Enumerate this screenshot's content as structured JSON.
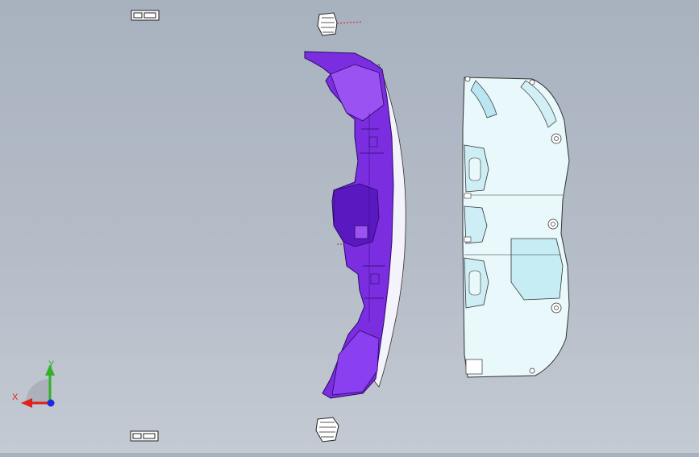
{
  "viewport": {
    "axis_triad": {
      "x_label": "X",
      "y_label": "Y",
      "x_color": "#e0201c",
      "y_color": "#2fb12a",
      "z_color": "#1c2bd8"
    },
    "part_colors": {
      "purple_panel": "#7a2ee0",
      "purple_dark": "#4a10a8",
      "clear_cover": "#e9f8fb",
      "clear_cover_accent": "#b9e6f0"
    },
    "icons": [
      "axis-triad-icon",
      "clip-fastener-icon",
      "bracket-part-icon"
    ]
  }
}
